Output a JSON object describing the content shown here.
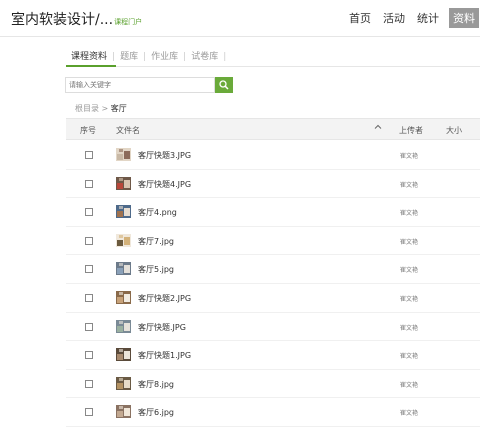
{
  "header": {
    "title": "室内软装设计/...",
    "portal": "课程门户",
    "nav": [
      "首页",
      "活动",
      "统计",
      "资料"
    ],
    "active_nav": "资料"
  },
  "tabs": [
    "课程资料",
    "题库",
    "作业库",
    "试卷库"
  ],
  "search": {
    "placeholder": "请输入关键字"
  },
  "breadcrumb": {
    "root": "根目录",
    "separator": ">",
    "current": "客厅"
  },
  "table": {
    "headers": {
      "index": "序号",
      "filename": "文件名",
      "uploader": "上传者",
      "size": "大小"
    },
    "rows": [
      {
        "name": "客厅快题3.JPG",
        "uploader": "崔文艳"
      },
      {
        "name": "客厅快题4.JPG",
        "uploader": "崔文艳"
      },
      {
        "name": "客厅4.png",
        "uploader": "崔文艳"
      },
      {
        "name": "客厅7.jpg",
        "uploader": "崔文艳"
      },
      {
        "name": "客厅5.jpg",
        "uploader": "崔文艳"
      },
      {
        "name": "客厅快题2.JPG",
        "uploader": "崔文艳"
      },
      {
        "name": "客厅快题.JPG",
        "uploader": "崔文艳"
      },
      {
        "name": "客厅快题1.JPG",
        "uploader": "崔文艳"
      },
      {
        "name": "客厅8.jpg",
        "uploader": "崔文艳"
      },
      {
        "name": "客厅6.jpg",
        "uploader": "崔文艳"
      }
    ]
  },
  "colors": {
    "accent": "#5aa02c",
    "search_button": "#6aaa3a",
    "active_nav_bg": "#999999"
  }
}
